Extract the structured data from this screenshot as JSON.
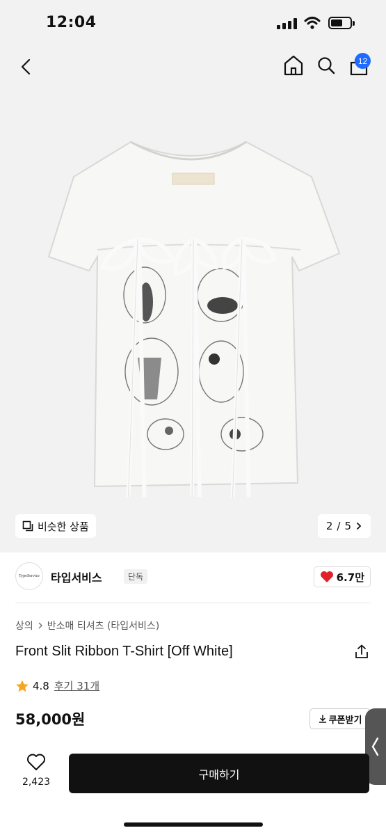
{
  "status": {
    "time": "12:04"
  },
  "header": {
    "cart_count": "12"
  },
  "hero": {
    "similar_label": "비슷한 상품",
    "page_current": "2",
    "page_sep": "/",
    "page_total": "5"
  },
  "brand": {
    "logo_text": "TypeService",
    "name": "타입서비스",
    "tag": "단독",
    "likes": "6.7만"
  },
  "product": {
    "breadcrumb": [
      "상의",
      "반소매 티셔츠 (타입서비스)"
    ],
    "title": "Front Slit Ribbon T-Shirt [Off White]",
    "rating": "4.8",
    "review_label": "후기 31개",
    "price": "58,000원",
    "coupon_label": "쿠폰받기"
  },
  "bottom": {
    "like_count": "2,423",
    "buy_label": "구매하기"
  },
  "colors": {
    "accent_badge": "#1f6bff",
    "heart": "#e0202a",
    "star": "#f5a623",
    "buy_bg": "#111111"
  }
}
